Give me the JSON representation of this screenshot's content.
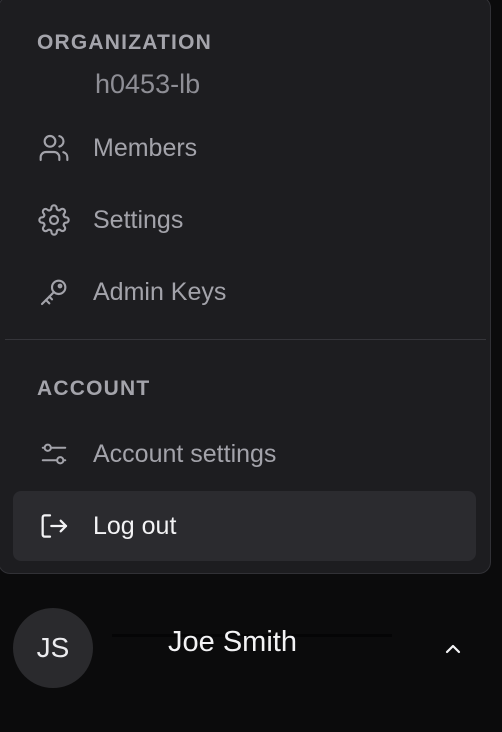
{
  "organization": {
    "heading": "ORGANIZATION",
    "name": "h0453-lb",
    "items": [
      {
        "label": "Members",
        "icon": "users-icon"
      },
      {
        "label": "Settings",
        "icon": "gear-icon"
      },
      {
        "label": "Admin Keys",
        "icon": "key-icon"
      }
    ]
  },
  "account": {
    "heading": "ACCOUNT",
    "items": [
      {
        "label": "Account settings",
        "icon": "sliders-icon"
      },
      {
        "label": "Log out",
        "icon": "logout-icon",
        "active": true
      }
    ]
  },
  "user": {
    "initials": "JS",
    "name": "Joe Smith",
    "toggle_icon": "chevron-up-icon"
  },
  "colors": {
    "menu_background": "#1d1d20",
    "active_item_background": "#2b2b2f",
    "muted_text": "#a3a3aa",
    "bright_text": "#f3f3f5"
  }
}
